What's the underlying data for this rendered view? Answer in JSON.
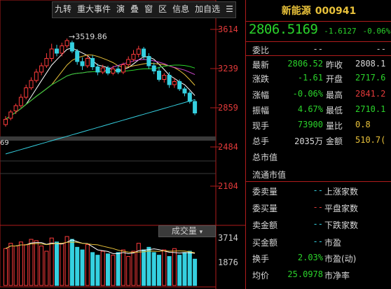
{
  "toolbar": {
    "items": [
      {
        "label": "九转"
      },
      {
        "label": "重大事件"
      },
      {
        "label": "演"
      },
      {
        "label": "叠"
      },
      {
        "label": "窗"
      },
      {
        "label": "区"
      },
      {
        "label": "信息"
      },
      {
        "label": "加自选"
      }
    ],
    "menu_icon": "menu-icon"
  },
  "chart": {
    "price_axis": [
      "3614",
      "3239",
      "2859",
      "2484",
      "2104"
    ],
    "vol_axis": [
      "3714",
      "1876"
    ],
    "high_marker": "3519.86",
    "low_marker_text": "69",
    "vol_tab_label": "成交量"
  },
  "chart_data": {
    "type": "candlestick",
    "ylim": [
      2000,
      3700
    ],
    "candles": [
      {
        "o": 2700,
        "c": 2750,
        "h": 2780,
        "l": 2680
      },
      {
        "o": 2760,
        "c": 2820,
        "h": 2840,
        "l": 2740
      },
      {
        "o": 2830,
        "c": 2880,
        "h": 2900,
        "l": 2800
      },
      {
        "o": 2880,
        "c": 2960,
        "h": 2990,
        "l": 2860
      },
      {
        "o": 2960,
        "c": 3050,
        "h": 3080,
        "l": 2940
      },
      {
        "o": 3050,
        "c": 3120,
        "h": 3150,
        "l": 3030
      },
      {
        "o": 3120,
        "c": 3200,
        "h": 3230,
        "l": 3100
      },
      {
        "o": 3200,
        "c": 3260,
        "h": 3290,
        "l": 3170
      },
      {
        "o": 3260,
        "c": 3330,
        "h": 3380,
        "l": 3240
      },
      {
        "o": 3330,
        "c": 3420,
        "h": 3470,
        "l": 3300
      },
      {
        "o": 3420,
        "c": 3380,
        "h": 3460,
        "l": 3350
      },
      {
        "o": 3380,
        "c": 3450,
        "h": 3480,
        "l": 3350
      },
      {
        "o": 3450,
        "c": 3500,
        "h": 3519.86,
        "l": 3430
      },
      {
        "o": 3480,
        "c": 3400,
        "h": 3500,
        "l": 3380
      },
      {
        "o": 3400,
        "c": 3300,
        "h": 3420,
        "l": 3270
      },
      {
        "o": 3300,
        "c": 3260,
        "h": 3340,
        "l": 3220
      },
      {
        "o": 3260,
        "c": 3330,
        "h": 3360,
        "l": 3240
      },
      {
        "o": 3330,
        "c": 3250,
        "h": 3360,
        "l": 3220
      },
      {
        "o": 3250,
        "c": 3200,
        "h": 3280,
        "l": 3170
      },
      {
        "o": 3200,
        "c": 3240,
        "h": 3270,
        "l": 3180
      },
      {
        "o": 3240,
        "c": 3190,
        "h": 3260,
        "l": 3170
      },
      {
        "o": 3190,
        "c": 3230,
        "h": 3260,
        "l": 3170
      },
      {
        "o": 3230,
        "c": 3200,
        "h": 3260,
        "l": 3180
      },
      {
        "o": 3200,
        "c": 3270,
        "h": 3290,
        "l": 3180
      },
      {
        "o": 3270,
        "c": 3320,
        "h": 3350,
        "l": 3250
      },
      {
        "o": 3320,
        "c": 3370,
        "h": 3410,
        "l": 3300
      },
      {
        "o": 3370,
        "c": 3420,
        "h": 3450,
        "l": 3340
      },
      {
        "o": 3420,
        "c": 3350,
        "h": 3440,
        "l": 3320
      },
      {
        "o": 3350,
        "c": 3260,
        "h": 3380,
        "l": 3230
      },
      {
        "o": 3260,
        "c": 3210,
        "h": 3290,
        "l": 3180
      },
      {
        "o": 3210,
        "c": 3130,
        "h": 3250,
        "l": 3110
      },
      {
        "o": 3130,
        "c": 3170,
        "h": 3190,
        "l": 3100
      },
      {
        "o": 3170,
        "c": 3080,
        "h": 3200,
        "l": 3050
      },
      {
        "o": 3080,
        "c": 3110,
        "h": 3140,
        "l": 3050
      },
      {
        "o": 3110,
        "c": 3040,
        "h": 3130,
        "l": 3020
      },
      {
        "o": 3040,
        "c": 3000,
        "h": 3060,
        "l": 2970
      },
      {
        "o": 3000,
        "c": 2920,
        "h": 3020,
        "l": 2900
      },
      {
        "o": 2920,
        "c": 2810,
        "h": 2940,
        "l": 2790
      }
    ],
    "volumes": [
      2800,
      3200,
      3000,
      3300,
      3100,
      3500,
      3400,
      3000,
      2600,
      3600,
      3300,
      3200,
      3714,
      3500,
      2900,
      2700,
      3100,
      2500,
      2300,
      2600,
      2400,
      2300,
      2500,
      2700,
      2200,
      2600,
      3200,
      2700,
      2900,
      2500,
      2300,
      2700,
      2200,
      2800,
      2300,
      2500,
      2600,
      2000
    ]
  },
  "stock": {
    "name": "新能源",
    "code": "000941",
    "price": "2806.5169",
    "change": "-1.6127",
    "change_pct": "-0.06%"
  },
  "panel": {
    "weibi_label": "委比",
    "weibi_value": "--",
    "weicha_value": "--",
    "rows": [
      {
        "l1": "最新",
        "v1": "2806.52",
        "c1": "green",
        "l2": "昨收",
        "v2": "2808.1",
        "c2": "white"
      },
      {
        "l1": "涨跌",
        "v1": "-1.61",
        "c1": "green",
        "l2": "开盘",
        "v2": "2717.6",
        "c2": "green"
      },
      {
        "l1": "涨幅",
        "v1": "-0.06%",
        "c1": "green",
        "l2": "最高",
        "v2": "2841.2",
        "c2": "red"
      },
      {
        "l1": "振幅",
        "v1": "4.67%",
        "c1": "green",
        "l2": "最低",
        "v2": "2710.1",
        "c2": "green"
      },
      {
        "l1": "现手",
        "v1": "73900",
        "c1": "green",
        "l2": "量比",
        "v2": "0.8",
        "c2": "yellow"
      },
      {
        "l1": "总手",
        "v1": "2035万",
        "c1": "white",
        "l2": "金额",
        "v2": "510.7(",
        "c2": "yellow"
      }
    ],
    "total_mv_label": "总市值",
    "float_mv_label": "流通市值",
    "stats": [
      {
        "l1": "委卖量",
        "v1": "--",
        "c1": "cyan",
        "l2": "上涨家数"
      },
      {
        "l1": "委买量",
        "v1": "--",
        "c1": "red",
        "l2": "平盘家数"
      },
      {
        "l1": "卖金额",
        "v1": "--",
        "c1": "cyan",
        "l2": "下跌家数"
      },
      {
        "l1": "买金额",
        "v1": "--",
        "c1": "cyan",
        "l2": "市盈"
      },
      {
        "l1": "换手",
        "v1": "2.03%",
        "c1": "green",
        "l2": "市盈(动)"
      },
      {
        "l1": "均价",
        "v1": "25.0978",
        "c1": "green",
        "l2": "市净率"
      }
    ]
  }
}
